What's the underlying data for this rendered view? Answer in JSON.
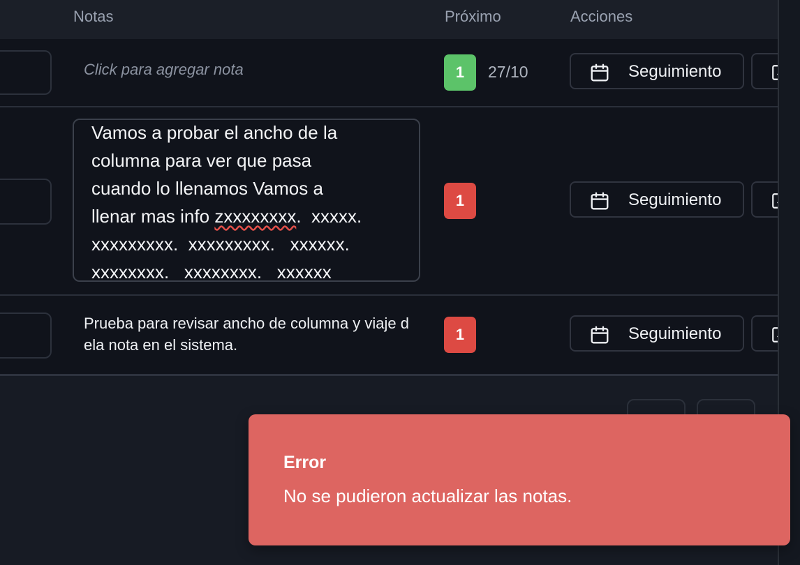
{
  "table": {
    "headers": {
      "notes": "Notas",
      "next": "Próximo",
      "actions": "Acciones"
    },
    "rows": [
      {
        "note_placeholder": "Click para agregar nota",
        "badge": "1",
        "badge_color": "#5cc369",
        "date": "27/10",
        "action_label": "Seguimiento"
      },
      {
        "note_lines": [
          "Vamos a probar el ancho de la",
          "columna para ver que pasa",
          "cuando lo llenamos Vamos a",
          "llenar mas info ",
          "zxxxxxxxx",
          ".  xxxxx.",
          "xxxxxxxxx.  xxxxxxxxx.   xxxxxx.",
          "xxxxxxxx.   xxxxxxxx.   xxxxxx"
        ],
        "badge": "1",
        "badge_color": "#dd4a43",
        "action_label": "Seguimiento"
      },
      {
        "note_text": "Prueba para revisar ancho de columna y viaje d ela nota en el sistema.",
        "badge": "1",
        "badge_color": "#dd4a43",
        "action_label": "Seguimiento"
      }
    ]
  },
  "icons": {
    "calendar": "calendar-icon",
    "edit": "edit-icon"
  },
  "toast": {
    "title": "Error",
    "description": "No se pudieron actualizar las notas.",
    "color": "#dd6561"
  }
}
